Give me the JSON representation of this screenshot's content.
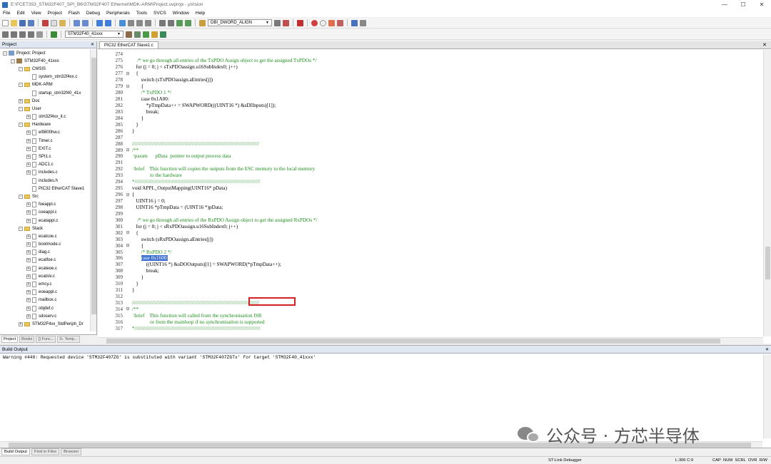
{
  "window": {
    "title": "E:\\FCET353_STM32F407_SPI_B6\\STM32F407 Ethernet\\MDK-ARM\\Project.uvprojx - µVision",
    "minimize": "—",
    "maximize": "☐",
    "close": "✕"
  },
  "menu": [
    "File",
    "Edit",
    "View",
    "Project",
    "Flash",
    "Debug",
    "Peripherals",
    "Tools",
    "SVCS",
    "Window",
    "Help"
  ],
  "toolbar": {
    "find_combo": "DBI_DWORD_ALIGN",
    "target_combo": "STM32F40_41xxx"
  },
  "project_panel": {
    "title": "Project",
    "pin": "✕",
    "tree": [
      {
        "label": "Project: Project",
        "indent": 0,
        "kind": "proj",
        "pm": "-"
      },
      {
        "label": "STM32F40_41xxx",
        "indent": 1,
        "kind": "target",
        "pm": "-"
      },
      {
        "label": "CMSIS",
        "indent": 2,
        "kind": "folder",
        "pm": "-"
      },
      {
        "label": "system_stm32f4xx.c",
        "indent": 3,
        "kind": "file",
        "pm": ""
      },
      {
        "label": "MDK-ARM",
        "indent": 2,
        "kind": "folder",
        "pm": "-"
      },
      {
        "label": "startup_stm32f40_41x",
        "indent": 3,
        "kind": "file",
        "pm": ""
      },
      {
        "label": "Doc",
        "indent": 2,
        "kind": "folder",
        "pm": "+"
      },
      {
        "label": "User",
        "indent": 2,
        "kind": "folder",
        "pm": "-"
      },
      {
        "label": "stm32f4xx_it.c",
        "indent": 3,
        "kind": "file",
        "pm": "+"
      },
      {
        "label": "Hardware",
        "indent": 2,
        "kind": "folder",
        "pm": "-"
      },
      {
        "label": "el9800hw.c",
        "indent": 3,
        "kind": "file",
        "pm": "+"
      },
      {
        "label": "Timer.c",
        "indent": 3,
        "kind": "file",
        "pm": "+"
      },
      {
        "label": "EXIT.c",
        "indent": 3,
        "kind": "file",
        "pm": "+"
      },
      {
        "label": "SPI1.c",
        "indent": 3,
        "kind": "file",
        "pm": "+"
      },
      {
        "label": "ADC1.c",
        "indent": 3,
        "kind": "file",
        "pm": "+"
      },
      {
        "label": "includes.c",
        "indent": 3,
        "kind": "file",
        "pm": "+"
      },
      {
        "label": "includes.h",
        "indent": 3,
        "kind": "file",
        "pm": ""
      },
      {
        "label": "PIC32 EtherCAT Slave1",
        "indent": 3,
        "kind": "file",
        "pm": ""
      },
      {
        "label": "Src",
        "indent": 2,
        "kind": "folder",
        "pm": "-"
      },
      {
        "label": "foeappl.c",
        "indent": 3,
        "kind": "file",
        "pm": "+"
      },
      {
        "label": "coeappl.c",
        "indent": 3,
        "kind": "file",
        "pm": "+"
      },
      {
        "label": "ecatappl.c",
        "indent": 3,
        "kind": "file",
        "pm": "+"
      },
      {
        "label": "Stack",
        "indent": 2,
        "kind": "folder",
        "pm": "-"
      },
      {
        "label": "ecatcoe.c",
        "indent": 3,
        "kind": "file",
        "pm": "+"
      },
      {
        "label": "bootmode.c",
        "indent": 3,
        "kind": "file",
        "pm": "+"
      },
      {
        "label": "diag.c",
        "indent": 3,
        "kind": "file",
        "pm": "+"
      },
      {
        "label": "ecatfoe.c",
        "indent": 3,
        "kind": "file",
        "pm": "+"
      },
      {
        "label": "ecateoe.c",
        "indent": 3,
        "kind": "file",
        "pm": "+"
      },
      {
        "label": "ecatslv.c",
        "indent": 3,
        "kind": "file",
        "pm": "+"
      },
      {
        "label": "emcy.c",
        "indent": 3,
        "kind": "file",
        "pm": "+"
      },
      {
        "label": "eoeappl.c",
        "indent": 3,
        "kind": "file",
        "pm": "+"
      },
      {
        "label": "mailbox.c",
        "indent": 3,
        "kind": "file",
        "pm": "+"
      },
      {
        "label": "objdef.c",
        "indent": 3,
        "kind": "file",
        "pm": "+"
      },
      {
        "label": "sdoserv.c",
        "indent": 3,
        "kind": "file",
        "pm": "+"
      },
      {
        "label": "STM32F4xx_StdPeriph_Dr",
        "indent": 2,
        "kind": "folder",
        "pm": "+"
      }
    ],
    "tabs": [
      "Project",
      "Books",
      "{} Func...",
      "0↓ Temp..."
    ]
  },
  "editor": {
    "tab_label": "PIC32 EtherCAT Slave1.c",
    "tab_close": "✕",
    "lines": [
      {
        "n": "274",
        "f": "",
        "t": "",
        "c": false
      },
      {
        "n": "275",
        "f": "",
        "t": "    /* we go through all entries of the TxPDO Assign object to get the assigned TxPDOs */",
        "c": true
      },
      {
        "n": "276",
        "f": "",
        "t": "   for (j = 0; j < sTxPDOassign.u16SubIndex0; j++)",
        "c": false
      },
      {
        "n": "277",
        "f": "⊟",
        "t": "   {",
        "c": false
      },
      {
        "n": "278",
        "f": "",
        "t": "       switch (sTxPDOassign.aEntries[j])",
        "c": false
      },
      {
        "n": "279",
        "f": "⊟",
        "t": "       {",
        "c": false
      },
      {
        "n": "280",
        "f": "",
        "t": "       /* TxPDO 1 */",
        "c": true
      },
      {
        "n": "281",
        "f": "",
        "t": "       case 0x1A00:",
        "c": false
      },
      {
        "n": "282",
        "f": "",
        "t": "           *pTmpData++ = SWAPWORD(((UINT16 *) &sDIInputs)[1]);",
        "c": false
      },
      {
        "n": "283",
        "f": "",
        "t": "           break;",
        "c": false
      },
      {
        "n": "284",
        "f": "",
        "t": "       }",
        "c": false
      },
      {
        "n": "285",
        "f": "",
        "t": "   }",
        "c": false
      },
      {
        "n": "286",
        "f": "",
        "t": "}",
        "c": false
      },
      {
        "n": "287",
        "f": "",
        "t": "",
        "c": false
      },
      {
        "n": "288",
        "f": "",
        "t": "/////////////////////////////////////////////////////////////////////////////////////////",
        "c": true
      },
      {
        "n": "289",
        "f": "⊟",
        "t": "/**",
        "c": true
      },
      {
        "n": "290",
        "f": "",
        "t": " \\param      pData  pointer to output process data",
        "c": true
      },
      {
        "n": "291",
        "f": "",
        "t": "",
        "c": true
      },
      {
        "n": "292",
        "f": "",
        "t": " \\brief    This function will copies the outputs from the ESC memory to the local memory",
        "c": true
      },
      {
        "n": "293",
        "f": "",
        "t": "              to the hardware",
        "c": true
      },
      {
        "n": "294",
        "f": "",
        "t": "*////////////////////////////////////////////////////////////////////////////////////////",
        "c": true
      },
      {
        "n": "295",
        "f": "",
        "t": "void APPL_OutputMapping(UINT16* pData)",
        "c": false
      },
      {
        "n": "296",
        "f": "⊟",
        "t": "{",
        "c": false
      },
      {
        "n": "297",
        "f": "",
        "t": "   UINT16 j = 0;",
        "c": false
      },
      {
        "n": "298",
        "f": "",
        "t": "   UINT16 *pTmpData = (UINT16 *)pData;",
        "c": false
      },
      {
        "n": "299",
        "f": "",
        "t": "",
        "c": false
      },
      {
        "n": "300",
        "f": "",
        "t": "    /* we go through all entries of the RxPDO Assign object to get the assigned RxPDOs */",
        "c": true
      },
      {
        "n": "301",
        "f": "",
        "t": "   for (j = 0; j < sRxPDOassign.u16SubIndex0; j++)",
        "c": false
      },
      {
        "n": "302",
        "f": "⊟",
        "t": "   {",
        "c": false
      },
      {
        "n": "303",
        "f": "",
        "t": "       switch (sRxPDOassign.aEntries[j])",
        "c": false
      },
      {
        "n": "304",
        "f": "⊟",
        "t": "       {",
        "c": false
      },
      {
        "n": "305",
        "f": "",
        "t": "       /* RxPDO 2 */",
        "c": true
      },
      {
        "n": "306",
        "f": "",
        "t": "       case 0x1600:",
        "c": false
      },
      {
        "n": "307",
        "f": "",
        "t": "           ((UINT16 *) &sDOOutputs)[1] = SWAPWORD(*pTmpData++);",
        "c": false
      },
      {
        "n": "308",
        "f": "",
        "t": "           break;",
        "c": false
      },
      {
        "n": "309",
        "f": "",
        "t": "       }",
        "c": false
      },
      {
        "n": "310",
        "f": "",
        "t": "   }",
        "c": false
      },
      {
        "n": "311",
        "f": "",
        "t": "}",
        "c": false
      },
      {
        "n": "312",
        "f": "",
        "t": "",
        "c": false
      },
      {
        "n": "313",
        "f": "",
        "t": "/////////////////////////////////////////////////////////////////////////////////////////",
        "c": true
      },
      {
        "n": "314",
        "f": "⊟",
        "t": "/**",
        "c": true
      },
      {
        "n": "315",
        "f": "",
        "t": " \\brief    This function will called from the synchronisation ISR",
        "c": true
      },
      {
        "n": "316",
        "f": "",
        "t": "              or from the mainloop if no synchronisation is supported",
        "c": true
      },
      {
        "n": "317",
        "f": "",
        "t": "*////////////////////////////////////////////////////////////////////////////////////////",
        "c": true
      }
    ],
    "highlight_line": "306"
  },
  "build_output": {
    "title": "Build Output",
    "pin": "✕",
    "text": "Warning #440: Requested device 'STM32F407ZG' is substituted with variant 'STM32F407ZGTx' for target 'STM32F40_41xxx'"
  },
  "bottom_tabs": [
    "Build Output",
    "Find in Files",
    "Browser"
  ],
  "status": {
    "debugger": "ST-Link Debugger",
    "position": "L:306 C:9",
    "keys": "CAP  NUM  SCRL  OVR  R/W"
  },
  "watermark": {
    "text": "公众号 · 方芯半导体"
  },
  "colors": {
    "comment": "#1c8f1c",
    "highlight_box": "#d42020",
    "selection": "#3d6fd0"
  }
}
